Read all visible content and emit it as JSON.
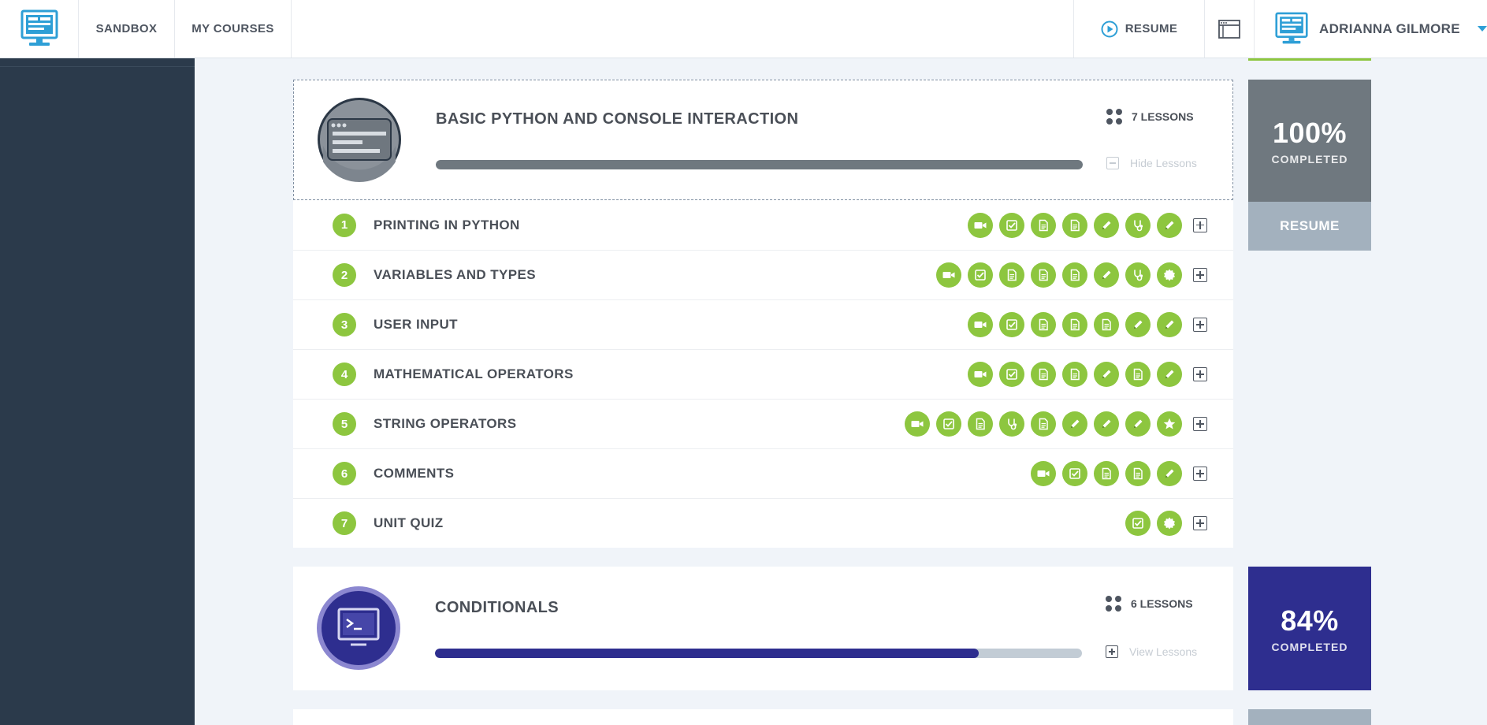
{
  "topbar": {
    "nav": [
      "SANDBOX",
      "MY COURSES"
    ],
    "resume_label": "RESUME",
    "user_name": "ADRIANNA GILMORE"
  },
  "courses": [
    {
      "title": "BASIC PYTHON AND CONSOLE INTERACTION",
      "lessons_label": "7 LESSONS",
      "progress": 1.0,
      "toggle_label": "Hide Lessons",
      "percent": "100%",
      "completed_label": "COMPLETED",
      "resume_label": "RESUME",
      "color": "#6f787f",
      "lessons": [
        {
          "num": "1",
          "title": "PRINTING IN PYTHON",
          "icons": [
            "video-icon",
            "checkbox-icon",
            "document-icon",
            "document-icon",
            "pencil-icon",
            "stethoscope-icon",
            "pencil-icon"
          ]
        },
        {
          "num": "2",
          "title": "VARIABLES AND TYPES",
          "icons": [
            "video-icon",
            "checkbox-icon",
            "document-icon",
            "document-icon",
            "document-icon",
            "pencil-icon",
            "stethoscope-icon",
            "badge-icon"
          ]
        },
        {
          "num": "3",
          "title": "USER INPUT",
          "icons": [
            "video-icon",
            "checkbox-icon",
            "document-icon",
            "document-icon",
            "document-icon",
            "pencil-icon",
            "pencil-icon"
          ]
        },
        {
          "num": "4",
          "title": "MATHEMATICAL OPERATORS",
          "icons": [
            "video-icon",
            "checkbox-icon",
            "document-icon",
            "document-icon",
            "pencil-icon",
            "document-icon",
            "pencil-icon"
          ]
        },
        {
          "num": "5",
          "title": "STRING OPERATORS",
          "icons": [
            "video-icon",
            "checkbox-icon",
            "document-icon",
            "stethoscope-icon",
            "document-icon",
            "pencil-icon",
            "pencil-icon",
            "pencil-icon",
            "star-icon"
          ]
        },
        {
          "num": "6",
          "title": "COMMENTS",
          "icons": [
            "video-icon",
            "checkbox-icon",
            "document-icon",
            "document-icon",
            "pencil-icon"
          ]
        },
        {
          "num": "7",
          "title": "UNIT QUIZ",
          "icons": [
            "checkbox-icon",
            "badge-icon"
          ]
        }
      ]
    },
    {
      "title": "CONDITIONALS",
      "lessons_label": "6 LESSONS",
      "progress": 0.84,
      "toggle_label": "View Lessons",
      "percent": "84%",
      "completed_label": "COMPLETED",
      "color": "#2e2e8f"
    }
  ],
  "colors": {
    "accent_green": "#8dc63f",
    "sidebar": "#2b3a4b",
    "brand_blue": "#2e9fd6",
    "completed_gray": "#6f787f",
    "conditionals_purple": "#2e2e8f",
    "resume_button": "#a3b1be"
  }
}
